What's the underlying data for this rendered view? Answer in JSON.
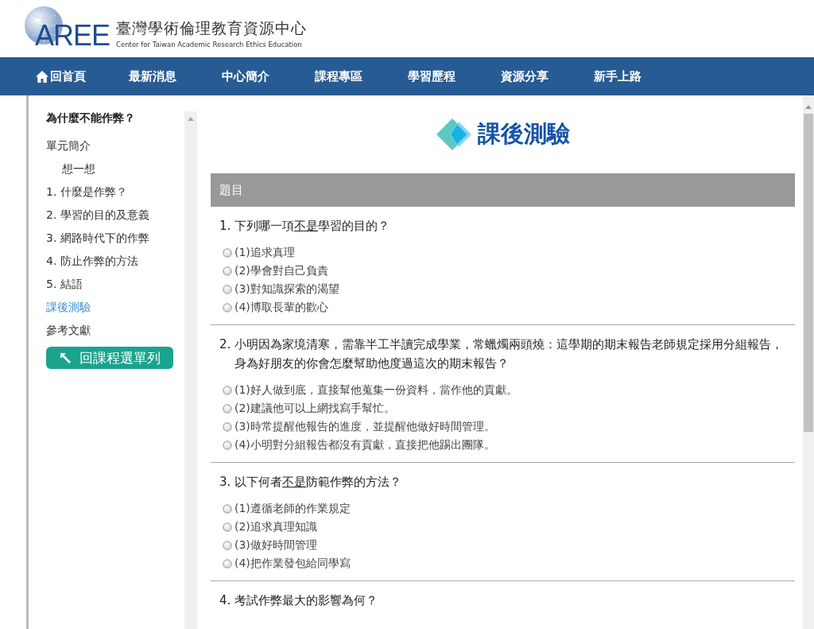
{
  "header": {
    "logo": "AREE",
    "title": "臺灣學術倫理教育資源中心",
    "subtitle": "Center for Taiwan Academic Research Ethics Education"
  },
  "nav": [
    {
      "label": "回首頁",
      "kind": "home"
    },
    {
      "label": "最新消息",
      "kind": "link"
    },
    {
      "label": "中心簡介",
      "kind": "link"
    },
    {
      "label": "課程專區",
      "kind": "link"
    },
    {
      "label": "學習歷程",
      "kind": "link"
    },
    {
      "label": "資源分享",
      "kind": "link"
    },
    {
      "label": "新手上路",
      "kind": "link"
    }
  ],
  "sidebar": {
    "title": "為什麼不能作弊？",
    "items": [
      {
        "label": "單元簡介",
        "selected": false,
        "children": [
          {
            "label": "想一想",
            "selected": false
          }
        ]
      },
      {
        "label": "1. 什麼是作弊？",
        "selected": false
      },
      {
        "label": "2. 學習的目的及意義",
        "selected": false
      },
      {
        "label": "3. 網路時代下的作弊",
        "selected": false
      },
      {
        "label": "4. 防止作弊的方法",
        "selected": false
      },
      {
        "label": "5. 結語",
        "selected": false
      },
      {
        "label": "課後測驗",
        "selected": true
      },
      {
        "label": "參考文獻",
        "selected": false
      }
    ],
    "back_button": "回課程選單列"
  },
  "page_title": "課後測驗",
  "table_header": "題目",
  "questions": [
    {
      "parts": [
        {
          "text": "1. 下列哪一項",
          "underline": false
        },
        {
          "text": "不是",
          "underline": true
        },
        {
          "text": "學習的目的？",
          "underline": false
        }
      ],
      "options": [
        {
          "label": "(1)追求真理",
          "selected": false
        },
        {
          "label": "(2)學會對自己負責",
          "selected": false
        },
        {
          "label": "(3)對知識探索的渴望",
          "selected": false
        },
        {
          "label": "(4)博取長輩的歡心",
          "selected": false
        }
      ]
    },
    {
      "parts": [
        {
          "text": "2. 小明因為家境清寒，需靠半工半讀完成學業，常蠟燭兩頭燒：這學期的期末報告老師規定採用分組報告，身為好朋友的你會怎麼幫助他度過這次的期末報告？",
          "underline": false
        }
      ],
      "options": [
        {
          "label": "(1)好人做到底，直接幫他蒐集一份資料，當作他的貢獻。",
          "selected": false
        },
        {
          "label": "(2)建議他可以上網找寫手幫忙。",
          "selected": false
        },
        {
          "label": "(3)時常提醒他報告的進度，並提醒他做好時間管理。",
          "selected": false
        },
        {
          "label": "(4)小明對分組報告都沒有貢獻，直接把他踢出團隊。",
          "selected": false
        }
      ]
    },
    {
      "parts": [
        {
          "text": "3. 以下何者",
          "underline": false
        },
        {
          "text": "不是",
          "underline": true
        },
        {
          "text": "防範作弊的方法？",
          "underline": false
        }
      ],
      "options": [
        {
          "label": "(1)遵循老師的作業規定",
          "selected": false
        },
        {
          "label": "(2)追求真理知識",
          "selected": false
        },
        {
          "label": "(3)做好時間管理",
          "selected": false
        },
        {
          "label": "(4)把作業發包給同學寫",
          "selected": false
        }
      ]
    },
    {
      "parts": [
        {
          "text": "4. 考試作弊最大的影響為何？",
          "underline": false
        }
      ]
    }
  ]
}
